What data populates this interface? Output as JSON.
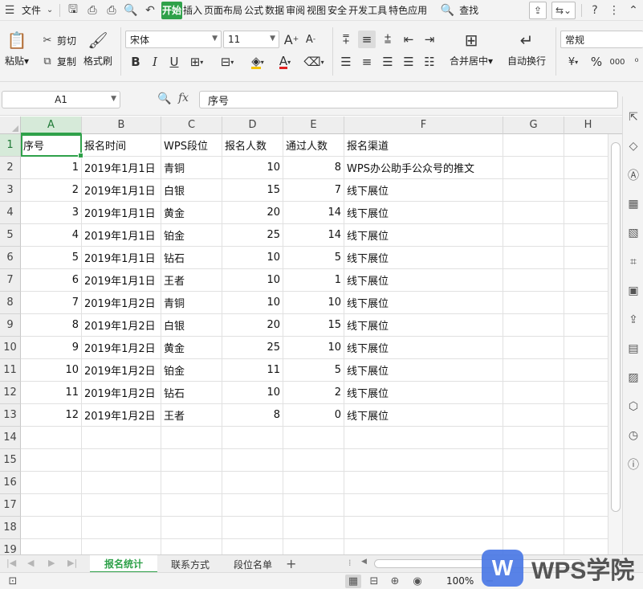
{
  "menubar": {
    "menu_label": "文件",
    "tabs": [
      "开始",
      "插入",
      "页面布局",
      "公式",
      "数据",
      "审阅",
      "视图",
      "安全",
      "开发工具",
      "特色应用"
    ],
    "active_tab": "开始",
    "search_label": "查找"
  },
  "ribbon": {
    "paste": "粘贴",
    "cut": "剪切",
    "copy": "复制",
    "format_painter": "格式刷",
    "font_name": "宋体",
    "font_size": "11",
    "merge_center": "合并居中",
    "wrap_text": "自动换行",
    "number_format": "常规",
    "bold": "B",
    "italic": "I",
    "underline": "U",
    "grow_font": "A",
    "shrink_font": "A",
    "currency": "¥",
    "percent": "%",
    "thousands": "000"
  },
  "formula_bar": {
    "name_box": "A1",
    "fx": "fx",
    "content": "序号"
  },
  "grid": {
    "columns": [
      "A",
      "B",
      "C",
      "D",
      "E",
      "F",
      "G",
      "H"
    ],
    "rows": [
      "1",
      "2",
      "3",
      "4",
      "5",
      "6",
      "7",
      "8",
      "9",
      "10",
      "11",
      "12",
      "13",
      "14",
      "15",
      "16",
      "17",
      "18",
      "19"
    ],
    "header": [
      "序号",
      "报名时间",
      "WPS段位",
      "报名人数",
      "通过人数",
      "报名渠道"
    ],
    "data": [
      [
        "1",
        "2019年1月1日",
        "青铜",
        "10",
        "8",
        "WPS办公助手公众号的推文"
      ],
      [
        "2",
        "2019年1月1日",
        "白银",
        "15",
        "7",
        "线下展位"
      ],
      [
        "3",
        "2019年1月1日",
        "黄金",
        "20",
        "14",
        "线下展位"
      ],
      [
        "4",
        "2019年1月1日",
        "铂金",
        "25",
        "14",
        "线下展位"
      ],
      [
        "5",
        "2019年1月1日",
        "钻石",
        "10",
        "5",
        "线下展位"
      ],
      [
        "6",
        "2019年1月1日",
        "王者",
        "10",
        "1",
        "线下展位"
      ],
      [
        "7",
        "2019年1月2日",
        "青铜",
        "10",
        "10",
        "线下展位"
      ],
      [
        "8",
        "2019年1月2日",
        "白银",
        "20",
        "15",
        "线下展位"
      ],
      [
        "9",
        "2019年1月2日",
        "黄金",
        "25",
        "10",
        "线下展位"
      ],
      [
        "10",
        "2019年1月2日",
        "铂金",
        "11",
        "5",
        "线下展位"
      ],
      [
        "11",
        "2019年1月2日",
        "钻石",
        "10",
        "2",
        "线下展位"
      ],
      [
        "12",
        "2019年1月2日",
        "王者",
        "8",
        "0",
        "线下展位"
      ]
    ]
  },
  "sheets": {
    "tabs": [
      "报名统计",
      "联系方式",
      "段位名单"
    ],
    "active": "报名统计",
    "add": "+"
  },
  "status": {
    "zoom": "100%"
  },
  "watermark": {
    "logo": "W",
    "text": "WPS学院"
  },
  "colors": {
    "accent": "#2fa14a",
    "logo_blue": "#4b79e6"
  }
}
